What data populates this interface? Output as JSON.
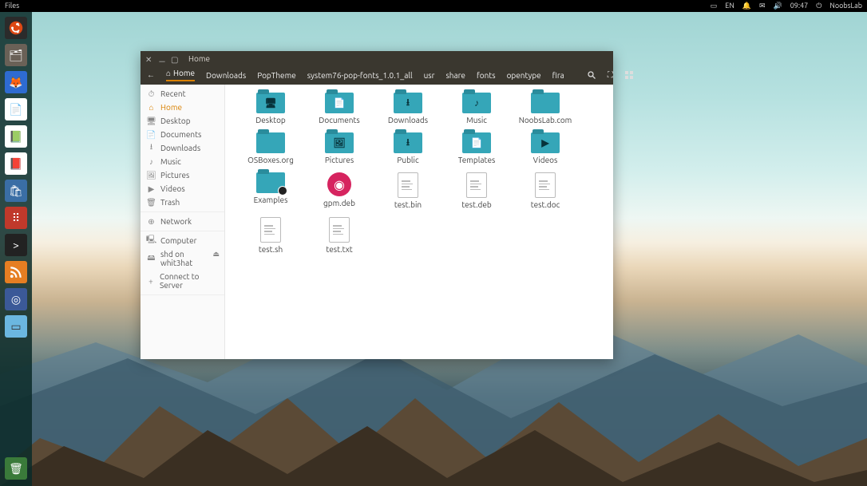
{
  "topbar": {
    "app_label": "Files",
    "lang": "EN",
    "time": "09:47",
    "user": "NoobsLab"
  },
  "launcher": {
    "items": [
      {
        "name": "dash-icon",
        "bg": "#2b2b2b",
        "glyph_svg": "ubuntu"
      },
      {
        "name": "files-icon",
        "bg": "#6a6157",
        "glyph": "🗂"
      },
      {
        "name": "firefox-icon",
        "bg": "#2e6bd1",
        "glyph": "🦊"
      },
      {
        "name": "writer-icon",
        "bg": "#ffffff",
        "glyph": "📄"
      },
      {
        "name": "calc-icon",
        "bg": "#ffffff",
        "glyph": "📗"
      },
      {
        "name": "impress-icon",
        "bg": "#ffffff",
        "glyph": "📕"
      },
      {
        "name": "software-icon",
        "bg": "#3a6ea5",
        "glyph": "🛍"
      },
      {
        "name": "palette-icon",
        "bg": "#c0392b",
        "glyph": "⠿"
      },
      {
        "name": "terminal-icon",
        "bg": "#222222",
        "glyph": ">"
      },
      {
        "name": "rss-icon",
        "bg": "#e67e22",
        "glyph_svg": "rss"
      },
      {
        "name": "messenger-icon",
        "bg": "#3b5998",
        "glyph": "◎"
      },
      {
        "name": "panel-icon",
        "bg": "#6bb7e0",
        "glyph": "▭"
      }
    ],
    "trash": {
      "name": "trash-icon",
      "bg": "#3a7a3a",
      "glyph": "🗑"
    }
  },
  "fm": {
    "title": "Home",
    "breadcrumb": [
      {
        "label": "Home",
        "active": true,
        "icon": "home"
      },
      {
        "label": "Downloads"
      },
      {
        "label": "PopTheme"
      },
      {
        "label": "system76-pop-fonts_1.0.1_all"
      },
      {
        "label": "usr"
      },
      {
        "label": "share"
      },
      {
        "label": "fonts"
      },
      {
        "label": "opentype"
      },
      {
        "label": "fira"
      }
    ],
    "sidebar": [
      {
        "group": [
          {
            "label": "Recent",
            "icon": "⏱",
            "name": "sidebar-item-recent"
          },
          {
            "label": "Home",
            "icon": "⌂",
            "name": "sidebar-item-home",
            "active": true
          },
          {
            "label": "Desktop",
            "icon": "🖥",
            "name": "sidebar-item-desktop"
          },
          {
            "label": "Documents",
            "icon": "📄",
            "name": "sidebar-item-documents"
          },
          {
            "label": "Downloads",
            "icon": "⭳",
            "name": "sidebar-item-downloads"
          },
          {
            "label": "Music",
            "icon": "♪",
            "name": "sidebar-item-music"
          },
          {
            "label": "Pictures",
            "icon": "🖼",
            "name": "sidebar-item-pictures"
          },
          {
            "label": "Videos",
            "icon": "▶",
            "name": "sidebar-item-videos"
          },
          {
            "label": "Trash",
            "icon": "🗑",
            "name": "sidebar-item-trash"
          }
        ]
      },
      {
        "group": [
          {
            "label": "Network",
            "icon": "⊕",
            "name": "sidebar-item-network"
          }
        ]
      },
      {
        "group": [
          {
            "label": "Computer",
            "icon": "🖳",
            "name": "sidebar-item-computer"
          },
          {
            "label": "shd on whit3hat",
            "icon": "🖴",
            "name": "sidebar-item-mount",
            "eject": true
          },
          {
            "label": "Connect to Server",
            "icon": "+",
            "name": "sidebar-item-connect"
          }
        ]
      }
    ],
    "items": [
      {
        "label": "Desktop",
        "type": "folder",
        "glyph": "🖥"
      },
      {
        "label": "Documents",
        "type": "folder",
        "glyph": "📄"
      },
      {
        "label": "Downloads",
        "type": "folder",
        "glyph": "⭳"
      },
      {
        "label": "Music",
        "type": "folder",
        "glyph": "♪"
      },
      {
        "label": "NoobsLab.com",
        "type": "folder",
        "glyph": ""
      },
      {
        "label": "OSBoxes.org",
        "type": "folder",
        "glyph": ""
      },
      {
        "label": "Pictures",
        "type": "folder",
        "glyph": "🖼"
      },
      {
        "label": "Public",
        "type": "folder",
        "glyph": "⭳"
      },
      {
        "label": "Templates",
        "type": "folder",
        "glyph": "📄"
      },
      {
        "label": "Videos",
        "type": "folder",
        "glyph": "▶"
      },
      {
        "label": "Examples",
        "type": "folder",
        "glyph": "",
        "badge": true
      },
      {
        "label": "gpm.deb",
        "type": "deb"
      },
      {
        "label": "test.bin",
        "type": "file"
      },
      {
        "label": "test.deb",
        "type": "file"
      },
      {
        "label": "test.doc",
        "type": "file"
      },
      {
        "label": "test.sh",
        "type": "file"
      },
      {
        "label": "test.txt",
        "type": "file"
      }
    ]
  }
}
